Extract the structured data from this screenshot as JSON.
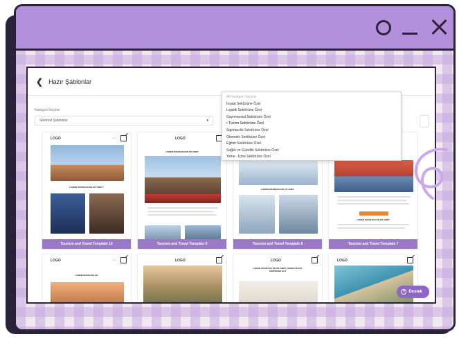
{
  "window": {
    "controls": [
      "circle",
      "minimize",
      "close"
    ]
  },
  "app": {
    "title": "Hazır Şablonlar",
    "filter": {
      "label": "Kategori Seçiniz",
      "value": "Sektörel Şablonlar"
    },
    "dropdown": {
      "options": [
        "Alt Kategori Seçiniz",
        "İnşaat Sektörüne Özel",
        "Lojistik Sektörüne Özel",
        "Gayrimenkul Sektörüne Özel",
        "Turizm Sektörüne Özel",
        "Sigortacılık Sektörüne Özel",
        "Otomotiv Sektörüne Özel",
        "Eğitim Sektörüne Özel",
        "Sağlık ve Güzellik Sektörüne Özel",
        "Yeme - İçme Sektörüne Özel"
      ]
    },
    "cards": [
      {
        "label": "Tourism and Travel Template 10",
        "logo": "LOGO",
        "text": "LOREM IPSUM DOLOR SIT AMET?"
      },
      {
        "label": "Tourism and Travel Template 9",
        "logo": "LOGO",
        "text": "LOREM IPSUM DOLOR SIT AMET"
      },
      {
        "label": "Tourism and Travel Template 8",
        "logo": "",
        "text": "LOREM IPSUM DOLOR SIT AMET"
      },
      {
        "label": "Tourism and Travel Template 7",
        "logo": "",
        "text": "LOREM IPSUM DOLOR SIT AMET"
      }
    ],
    "cards_row2": [
      {
        "logo": "LOGO",
        "text": "LOREM IPSUM DOLOR"
      },
      {
        "logo": "LOGO",
        "text": ""
      },
      {
        "logo": "LOGO",
        "text": "LOREM IPSUM DOLOR SIT AMET CONSECTETUR ADIPISCING ELIT"
      },
      {
        "logo": "LOGO",
        "text": ""
      }
    ],
    "support_label": "Destek"
  },
  "colors": {
    "accent": "#9c78c8",
    "titlebar": "#b48fdc",
    "outline": "#2a2238"
  }
}
